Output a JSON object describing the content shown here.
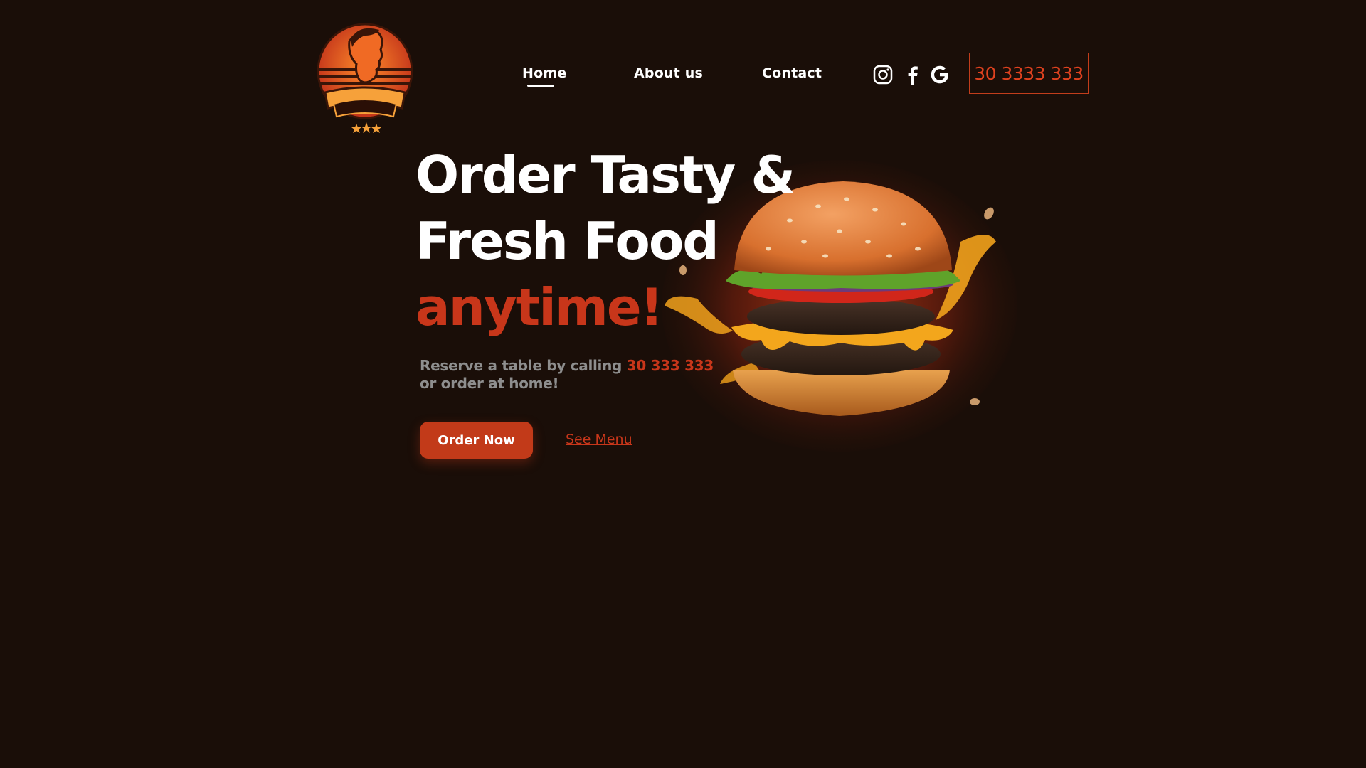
{
  "brand": {
    "logo_icon": "pomodoro-chef-logo"
  },
  "nav": {
    "items": [
      {
        "label": "Home",
        "active": true
      },
      {
        "label": "About us",
        "active": false
      },
      {
        "label": "Contact",
        "active": false
      }
    ]
  },
  "social": {
    "icons": [
      "instagram-icon",
      "facebook-icon",
      "google-icon"
    ]
  },
  "header": {
    "phone_button_label": "30 3333 333"
  },
  "hero": {
    "headline_line1": "Order Tasty &",
    "headline_line2": "Fresh Food",
    "headline_accent": "anytime!",
    "subtext_prefix": "Reserve a table by calling ",
    "subtext_phone": "30 333 333",
    "subtext_suffix": "or order at home!",
    "order_button_label": "Order Now",
    "menu_link_label": "See Menu",
    "image_icon": "burger-image"
  },
  "colors": {
    "background": "#1a0e08",
    "accent": "#c8361a",
    "text": "#ffffff",
    "muted": "#8e8e8e"
  }
}
